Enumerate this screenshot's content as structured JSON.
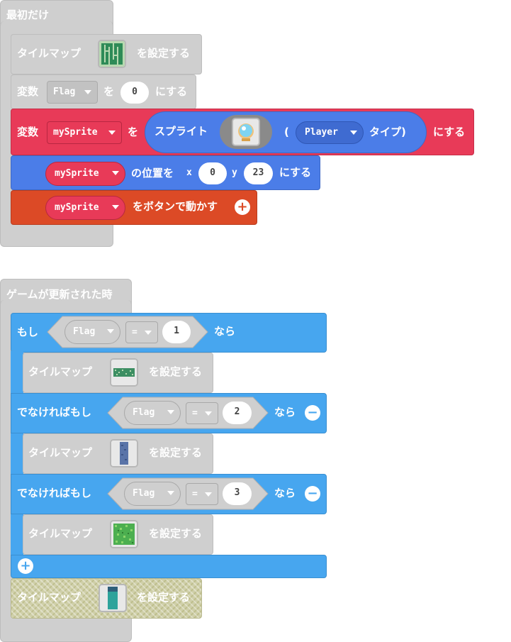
{
  "on_start": {
    "hat_label": "最初だけ",
    "set_tilemap_1": {
      "prefix": "タイルマップ",
      "suffix": "を設定する",
      "thumb_icon": "maze-tilemap-icon"
    },
    "set_var": {
      "prefix": "変数",
      "var": "Flag",
      "mid": "を",
      "value": "0",
      "suffix": "にする"
    },
    "set_sprite": {
      "prefix": "変数",
      "var": "mySprite",
      "mid": "を",
      "create_label": "スプライト",
      "thumb_icon": "orb-sprite-icon",
      "paren_open": "(",
      "kind": "Player",
      "kind_suffix": "タイプ)",
      "suffix": "にする"
    },
    "set_pos": {
      "var": "mySprite",
      "mid": "の位置を",
      "x_label": "x",
      "x": "0",
      "y_label": "y",
      "y": "23",
      "suffix": "にする"
    },
    "move_buttons": {
      "var": "mySprite",
      "suffix": "をボタンで動かす",
      "add_icon": "plus-circle-icon"
    }
  },
  "on_update": {
    "hat_label": "ゲームが更新された時",
    "if_label": "もし",
    "then_label": "なら",
    "elseif_label": "でなければもし",
    "conditions": [
      {
        "var": "Flag",
        "op": "=",
        "value": "1"
      },
      {
        "var": "Flag",
        "op": "=",
        "value": "2"
      },
      {
        "var": "Flag",
        "op": "=",
        "value": "3"
      }
    ],
    "branch_tilemap": {
      "prefix": "タイルマップ",
      "suffix": "を設定する"
    },
    "branch_icons": [
      "wide-green-tilemap-icon",
      "tall-blue-tilemap-icon",
      "green-noise-tilemap-icon"
    ],
    "remove_icon": "minus-circle-icon",
    "add_icon": "plus-circle-icon",
    "final_tilemap": {
      "prefix": "タイルマップ",
      "suffix": "を設定する",
      "thumb_icon": "teal-column-tilemap-icon"
    }
  }
}
